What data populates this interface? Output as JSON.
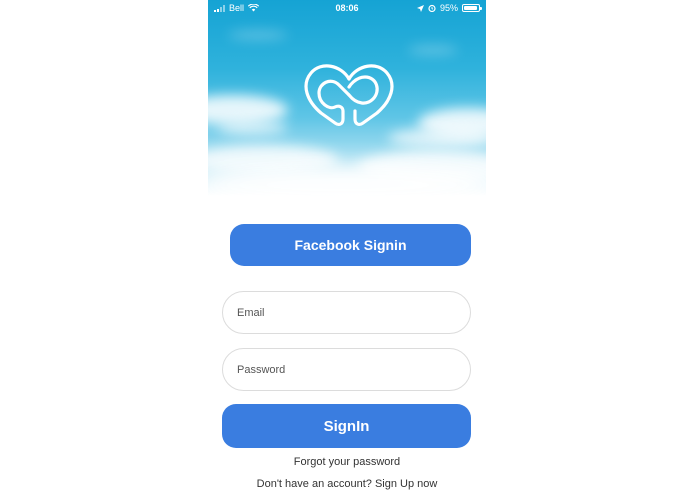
{
  "status_bar": {
    "carrier": "Bell",
    "time": "08:06",
    "battery": "95%",
    "battery_level": 0.95
  },
  "hero": {
    "logo_icon": "infinity-heart-icon"
  },
  "facebook_button": {
    "label": "Facebook Signin"
  },
  "email": {
    "placeholder": "Email",
    "value": ""
  },
  "password": {
    "placeholder": "Password",
    "value": ""
  },
  "signin_button": {
    "label": "SignIn"
  },
  "forgot_link": {
    "label": "Forgot your password"
  },
  "signup_link": {
    "label": "Don't have an account? Sign Up now"
  },
  "colors": {
    "primary": "#3a7de0",
    "sky": "#15a3d4"
  }
}
